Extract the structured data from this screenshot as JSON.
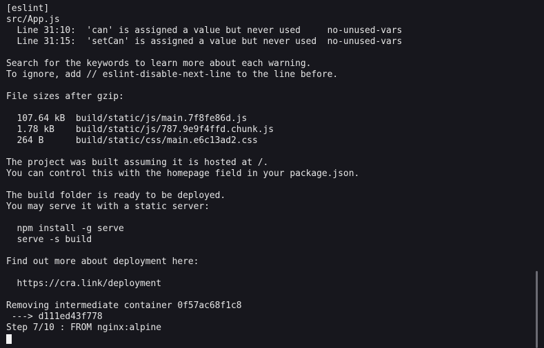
{
  "terminal": {
    "lines": [
      "[eslint]",
      "src/App.js",
      "  Line 31:10:  'can' is assigned a value but never used     no-unused-vars",
      "  Line 31:15:  'setCan' is assigned a value but never used  no-unused-vars",
      "",
      "Search for the keywords to learn more about each warning.",
      "To ignore, add // eslint-disable-next-line to the line before.",
      "",
      "File sizes after gzip:",
      "",
      "  107.64 kB  build/static/js/main.7f8fe86d.js",
      "  1.78 kB    build/static/js/787.9e9f4ffd.chunk.js",
      "  264 B      build/static/css/main.e6c13ad2.css",
      "",
      "The project was built assuming it is hosted at /.",
      "You can control this with the homepage field in your package.json.",
      "",
      "The build folder is ready to be deployed.",
      "You may serve it with a static server:",
      "",
      "  npm install -g serve",
      "  serve -s build",
      "",
      "Find out more about deployment here:",
      "",
      "  https://cra.link/deployment",
      "",
      "Removing intermediate container 0f57ac68f1c8",
      " ---> d111ed43f778",
      "Step 7/10 : FROM nginx:alpine"
    ],
    "background_color": "#17171d",
    "text_color": "#e6e6e6"
  }
}
